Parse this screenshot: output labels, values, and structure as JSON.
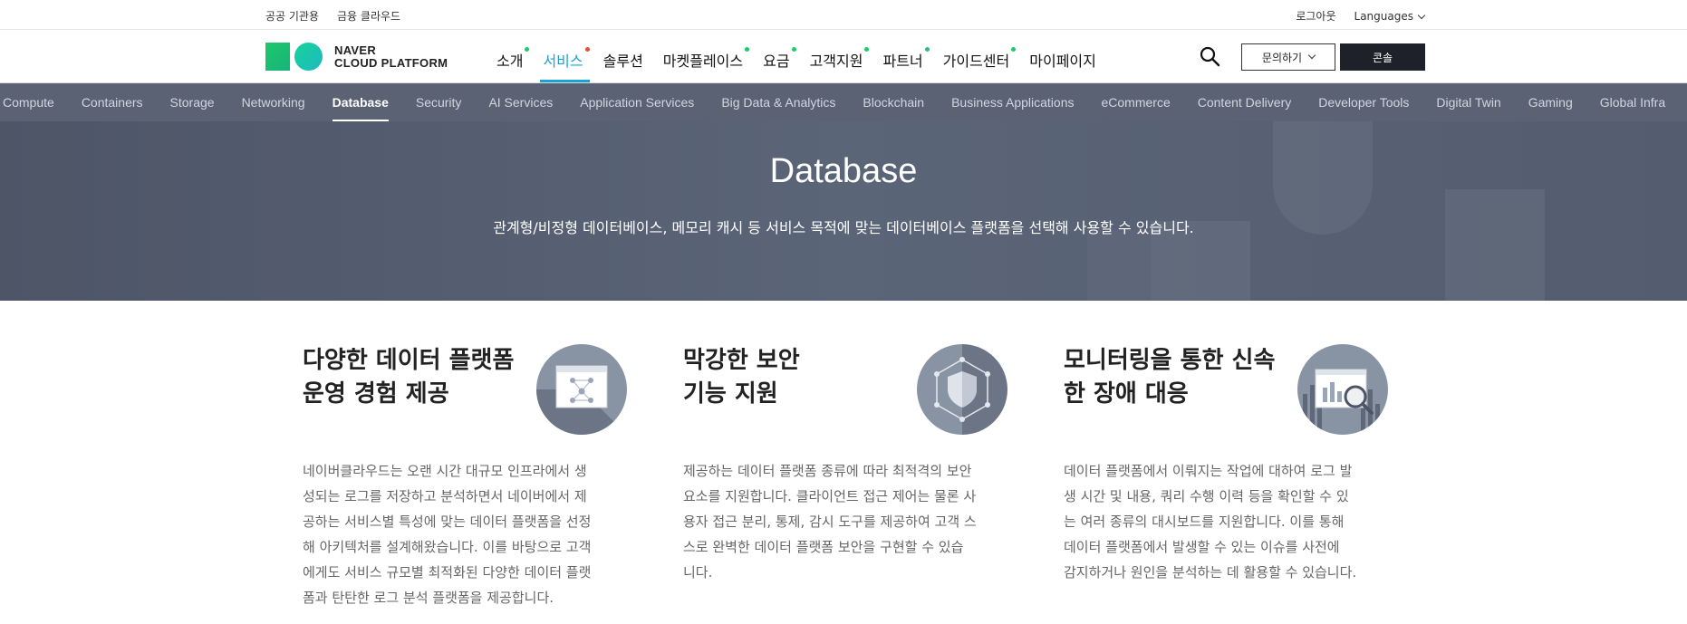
{
  "utility": {
    "left_links": [
      "공공 기관용",
      "금융 클라우드"
    ],
    "logout": "로그아웃",
    "languages": "Languages"
  },
  "header": {
    "logo_line1": "NAVER",
    "logo_line2": "CLOUD PLATFORM",
    "nav": [
      {
        "label": "소개",
        "dot": true
      },
      {
        "label": "서비스",
        "dot": true,
        "active": true
      },
      {
        "label": "솔루션",
        "dot": false
      },
      {
        "label": "마켓플레이스",
        "dot": true
      },
      {
        "label": "요금",
        "dot": true
      },
      {
        "label": "고객지원",
        "dot": true
      },
      {
        "label": "파트너",
        "dot": true
      },
      {
        "label": "가이드센터",
        "dot": true
      },
      {
        "label": "마이페이지",
        "dot": false
      }
    ],
    "inquiry_label": "문의하기",
    "console_label": "콘솔"
  },
  "categories": [
    "Compute",
    "Containers",
    "Storage",
    "Networking",
    "Database",
    "Security",
    "AI Services",
    "Application Services",
    "Big Data & Analytics",
    "Blockchain",
    "Business Applications",
    "eCommerce",
    "Content Delivery",
    "Developer Tools",
    "Digital Twin",
    "Gaming",
    "Global Infra"
  ],
  "active_category": "Database",
  "hero": {
    "title": "Database",
    "description": "관계형/비정형 데이터베이스, 메모리 캐시 등 서비스 목적에 맞는 데이터베이스 플랫폼을 선택해 사용할 수 있습니다."
  },
  "features": [
    {
      "title_line1": "다양한 데이터 플랫폼",
      "title_line2": "운영 경험 제공",
      "icon": "data-platform-icon",
      "desc_lines": [
        "네이버클라우드는 오랜 시간 대규모 인프라에서 생",
        "성되는 로그를 저장하고 분석하면서 네이버에서 제",
        "공하는 서비스별 특성에 맞는 데이터 플랫폼을 선정",
        "해 아키텍처를 설계해왔습니다. 이를 바탕으로 고객",
        "에게도 서비스 규모별 최적화된 다양한 데이터 플랫",
        "폼과 탄탄한 로그 분석 플랫폼을 제공합니다."
      ]
    },
    {
      "title_line1": "막강한 보안",
      "title_line2": "기능 지원",
      "icon": "shield-icon",
      "desc_lines": [
        "제공하는 데이터 플랫폼 종류에 따라 최적격의 보안",
        "요소를 지원합니다. 클라이언트 접근 제어는 물론 사",
        "용자 접근 분리, 통제, 감시 도구를 제공하여 고객 스",
        "스로 완벽한 데이터 플랫폼 보안을 구현할 수 있습",
        "니다."
      ]
    },
    {
      "title_line1": "모니터링을 통한 신속",
      "title_line2": "한 장애 대응",
      "icon": "monitoring-icon",
      "desc_lines": [
        "데이터 플랫폼에서 이뤄지는 작업에 대하여 로그 발",
        "생 시간 및 내용, 쿼리 수행 이력 등을 확인할 수 있",
        "는 여러 종류의 대시보드를 지원합니다. 이를 통해",
        "데이터 플랫폼에서 발생할 수 있는 이슈를 사전에",
        "감지하거나 원인을 분석하는 데 활용할 수 있습니다."
      ]
    }
  ]
}
